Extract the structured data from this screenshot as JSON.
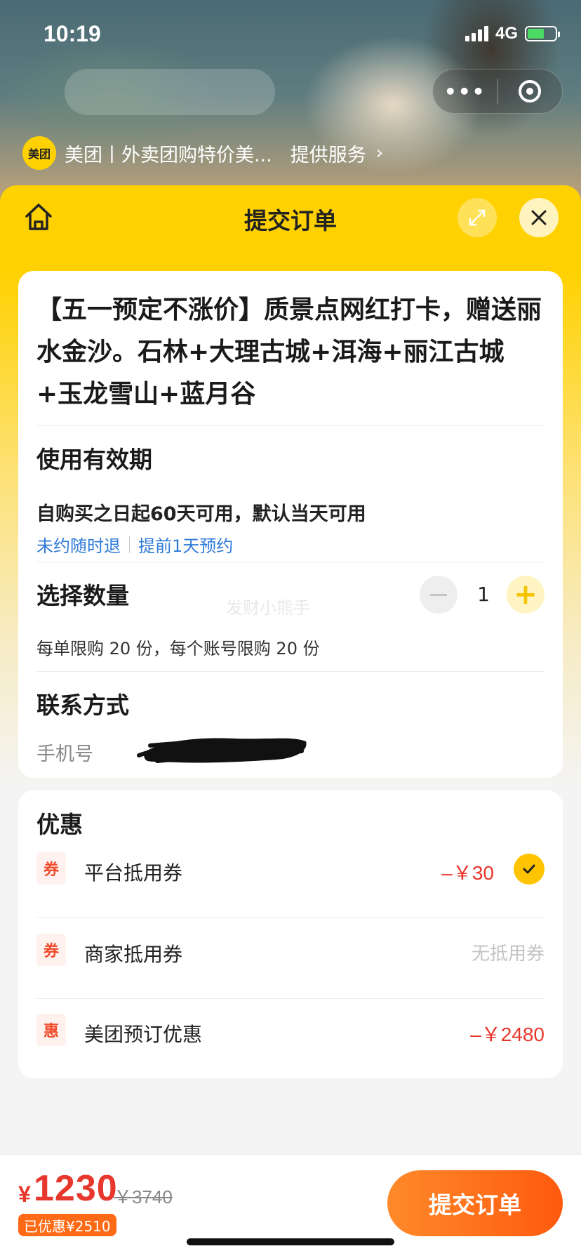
{
  "status_bar": {
    "time": "10:19",
    "network": "4G"
  },
  "merchant": {
    "logo_text": "美团",
    "name": "美团丨外卖团购特价美...",
    "service_label": "提供服务",
    "chevron": "›"
  },
  "capsule": {
    "more_label": "•••"
  },
  "sheet": {
    "title": "提交订单"
  },
  "product": {
    "title": "【五一预定不涨价】质景点网红打卡，赠送丽水金沙。石林+大理古城+洱海+丽江古城+玉龙雪山+蓝月谷"
  },
  "validity": {
    "title": "使用有效期",
    "text": "自购买之日起60天可用，默认当天可用",
    "tags": [
      "未约随时退",
      "提前1天预约"
    ]
  },
  "quantity": {
    "title": "选择数量",
    "value": "1",
    "plus_symbol": "+",
    "limit_text": "每单限购 20 份，每个账号限购 20 份",
    "watermark": "发财小熊手"
  },
  "contact": {
    "title": "联系方式",
    "phone_label": "手机号"
  },
  "promotions": {
    "title": "优惠",
    "items": [
      {
        "badge": "券",
        "label": "平台抵用券",
        "value": "–￥30",
        "checked": true
      },
      {
        "badge": "券",
        "label": "商家抵用券",
        "value": "无抵用券",
        "checked": false
      },
      {
        "badge": "惠",
        "label": "美团预订优惠",
        "value": "–￥2480",
        "checked": false
      }
    ]
  },
  "footer": {
    "currency": "¥",
    "price": "1230",
    "original_price": "￥3740",
    "saved": "已优惠¥2510",
    "submit_label": "提交订单"
  },
  "colors": {
    "brand_yellow": "#ffd100",
    "price_red": "#e8372c",
    "link_blue": "#2f7bd8",
    "cta_orange": "#ff5a0e"
  }
}
